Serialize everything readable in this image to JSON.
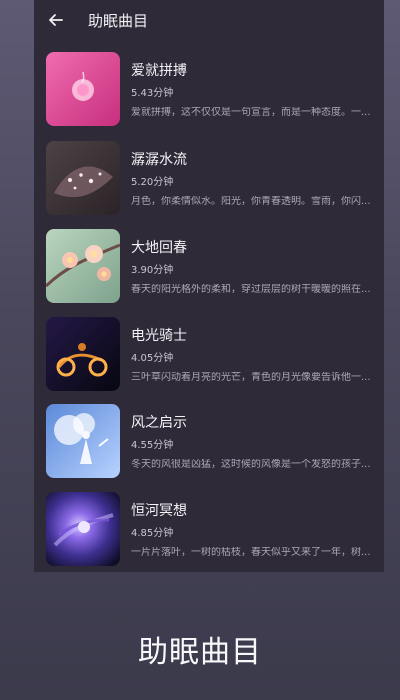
{
  "header": {
    "title": "助眠曲目"
  },
  "tracks": [
    {
      "title": "爱就拼搏",
      "duration": "5.43分钟",
      "description": "爱就拼搏，这不仅仅是一句宣言，而是一种态度。一..."
    },
    {
      "title": "潺潺水流",
      "duration": "5.20分钟",
      "description": "月色，你柔情似水。阳光，你青春透明。雪雨，你闪..."
    },
    {
      "title": "大地回春",
      "duration": "3.90分钟",
      "description": "春天的阳光格外的柔和，穿过层层的树干暖暖的照在..."
    },
    {
      "title": "电光骑士",
      "duration": "4.05分钟",
      "description": "三叶草闪动着月亮的光芒，青色的月光像要告诉他一..."
    },
    {
      "title": "风之启示",
      "duration": "4.55分钟",
      "description": "冬天的风很是凶猛，这时候的风像是一个发怒的孩子..."
    },
    {
      "title": "恒河冥想",
      "duration": "4.85分钟",
      "description": "一片片落叶，一树的枯枝，春天似乎又来了一年，树..."
    }
  ],
  "caption": "助眠曲目",
  "colors": {
    "background": "#4a475c",
    "panel": "#2f2a37",
    "primary_text": "#f3f3f6",
    "secondary_text": "#aaa7b6"
  },
  "icons": {
    "back": "arrow-left-icon"
  }
}
